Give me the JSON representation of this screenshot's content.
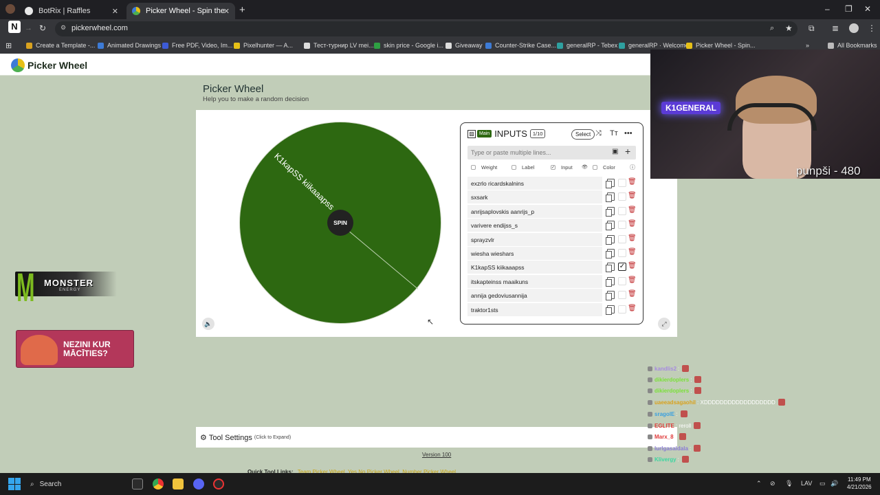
{
  "browser": {
    "tabs": [
      {
        "title": "BotRix | Raffles"
      },
      {
        "title": "Picker Wheel - Spin the Wheel"
      }
    ],
    "url": "pickerwheel.com",
    "bookmarks": [
      "Create a Template -...",
      "Animated Drawings",
      "Free PDF, Video, Im...",
      "Pixelhunter — A...",
      "Тест-турнир LV mei...",
      "skin price - Google i...",
      "Giveaway",
      "Counter-Strike Case...",
      "generalRP - Tebex",
      "generalRP · Welcome",
      "Picker Wheel - Spin..."
    ],
    "all_bookmarks": "All Bookmarks"
  },
  "site": {
    "logo": "Picker Wheel",
    "title": "Picker Wheel",
    "subtitle": "Help you to make a random decision"
  },
  "wheel": {
    "segment_label": "K1kapSS kiikaaapss",
    "spin_label": "SPIN",
    "color": "#2d6811"
  },
  "inputs_panel": {
    "main_badge": "Main",
    "title": "INPUTS",
    "count": "1/10",
    "select_label": "Select",
    "paste_placeholder": "Type or paste multiple lines...",
    "columns": [
      "Weight",
      "Label",
      "Input",
      "Color"
    ],
    "entries": [
      {
        "text": "exzrlo ricardskalnins",
        "checked": false
      },
      {
        "text": "sxsark",
        "checked": false
      },
      {
        "text": "anrijsaplovskis  aanrijs_p",
        "checked": false
      },
      {
        "text": "varivere endijss_s",
        "checked": false
      },
      {
        "text": "sprayzvlr",
        "checked": false
      },
      {
        "text": "wiesha wieshars",
        "checked": false
      },
      {
        "text": "K1kapSS kiikaaapss",
        "checked": true
      },
      {
        "text": "itskapteinss maaikuns",
        "checked": false
      },
      {
        "text": "annija gedoviusannija",
        "checked": false
      },
      {
        "text": "traktor1sts",
        "checked": false
      }
    ]
  },
  "ads": {
    "monster_brand": "MONSTER",
    "monster_sub": "ENERGY",
    "banner_text": "NEZINI KUR MĀCĪTIES?"
  },
  "stream": {
    "webcam_sign": "K1GENERAL",
    "webcam_caption": "punpši - 480",
    "chat": [
      {
        "user": "kandlis2",
        "msg": ":",
        "color": "#a78be0"
      },
      {
        "user": "dikierdoplers",
        "msg": ":",
        "color": "#7be03a"
      },
      {
        "user": "dikierdoplers",
        "msg": ":",
        "color": "#7be03a"
      },
      {
        "user": "uaeeadsagaohil",
        "msg": ": XDDDDDDDDDDDDDDDDDD",
        "color": "#d9a21f"
      },
      {
        "user": "sragolE",
        "msg": ":",
        "color": "#3aa0e0"
      },
      {
        "user": "EGLITE",
        "msg": ": reroll",
        "color": "#e03a3a"
      },
      {
        "user": "Marx_8",
        "msg": ":",
        "color": "#e03a3a"
      },
      {
        "user": "lurlgasaldala",
        "msg": ":",
        "color": "#8a7bd6"
      },
      {
        "user": "Klivergy",
        "msg": ":",
        "color": "#3ad6a0"
      }
    ]
  },
  "page_bottom": {
    "tool_settings": "Tool Settings",
    "tool_settings_hint": "(Click to Expand)",
    "version": "Version 100",
    "quick_tool_label": "Quick Tool Links:",
    "quick_links": "Team Picker Wheel, Yes No Picker Wheel, Number Picker Wheel"
  },
  "taskbar": {
    "search_placeholder": "Search",
    "lang": "LAV",
    "time": "11:49 PM",
    "date": "4/21/2026"
  }
}
